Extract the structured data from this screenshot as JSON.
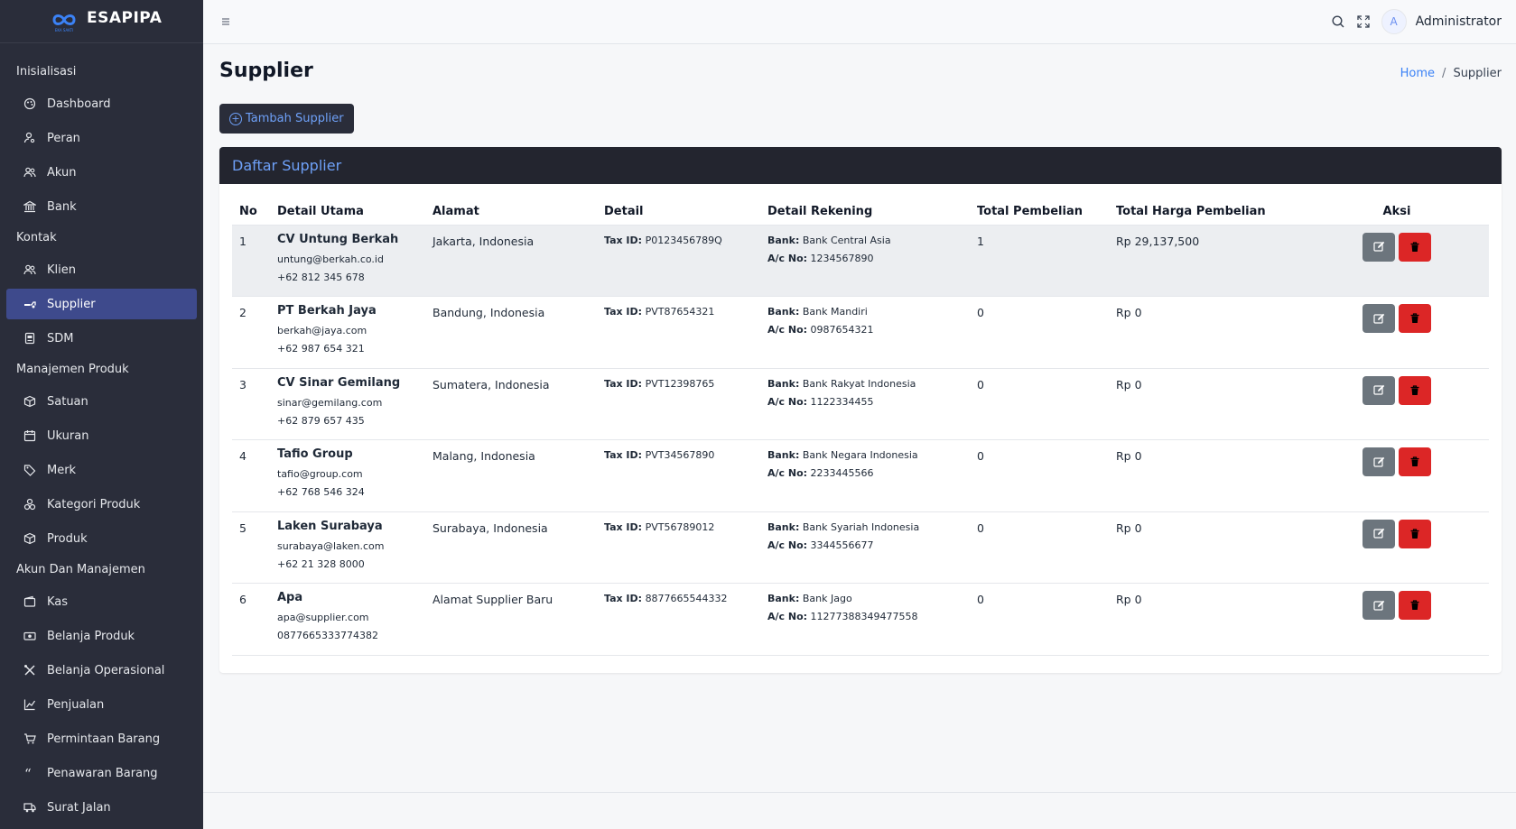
{
  "brand": {
    "name": "ESAPIPA",
    "logo_text": "EKA SAKTI"
  },
  "sidebar": {
    "sections": [
      {
        "title": "Inisialisasi",
        "items": [
          {
            "label": "Dashboard",
            "icon": "palette-icon"
          },
          {
            "label": "Peran",
            "icon": "user-key-icon"
          },
          {
            "label": "Akun",
            "icon": "users-icon"
          },
          {
            "label": "Bank",
            "icon": "bank-icon"
          }
        ]
      },
      {
        "title": "Kontak",
        "items": [
          {
            "label": "Klien",
            "icon": "users-icon"
          },
          {
            "label": "Supplier",
            "icon": "truck-icon",
            "active": true
          },
          {
            "label": "SDM",
            "icon": "id-card-icon"
          }
        ]
      },
      {
        "title": "Manajemen Produk",
        "items": [
          {
            "label": "Satuan",
            "icon": "box-icon"
          },
          {
            "label": "Ukuran",
            "icon": "calendar-icon"
          },
          {
            "label": "Merk",
            "icon": "tag-icon"
          },
          {
            "label": "Kategori Produk",
            "icon": "category-icon"
          },
          {
            "label": "Produk",
            "icon": "box-icon"
          }
        ]
      },
      {
        "title": "Akun Dan Manajemen",
        "items": [
          {
            "label": "Kas",
            "icon": "wallet-icon"
          },
          {
            "label": "Belanja Produk",
            "icon": "money-icon"
          },
          {
            "label": "Belanja Operasional",
            "icon": "tools-icon"
          },
          {
            "label": "Penjualan",
            "icon": "chart-line-icon"
          },
          {
            "label": "Permintaan Barang",
            "icon": "cart-icon"
          },
          {
            "label": "Penawaran Barang",
            "icon": "quote-icon"
          },
          {
            "label": "Surat Jalan",
            "icon": "delivery-truck-icon"
          }
        ]
      }
    ]
  },
  "topbar": {
    "user_initial": "A",
    "user_name": "Administrator"
  },
  "page": {
    "title": "Supplier"
  },
  "breadcrumb": {
    "home": "Home",
    "separator": "/",
    "current": "Supplier"
  },
  "add_button": {
    "label": "Tambah Supplier"
  },
  "card": {
    "title": "Daftar Supplier"
  },
  "table": {
    "headers": [
      "No",
      "Detail Utama",
      "Alamat",
      "Detail",
      "Detail Rekening",
      "Total Pembelian",
      "Total Harga Pembelian",
      "Aksi"
    ],
    "tax_label": "Tax ID:",
    "bank_label": "Bank:",
    "acc_label": "A/c No:",
    "rows": [
      {
        "no": "1",
        "name": "CV Untung Berkah",
        "email": "untung@berkah.co.id",
        "phone": "+62 812 345 678",
        "address": "Jakarta, Indonesia",
        "tax_id": "P0123456789Q",
        "bank": "Bank Central Asia",
        "acc_no": "1234567890",
        "total_purchase": "1",
        "total_price": "Rp 29,137,500"
      },
      {
        "no": "2",
        "name": "PT Berkah Jaya",
        "email": "berkah@jaya.com",
        "phone": "+62 987 654 321",
        "address": "Bandung, Indonesia",
        "tax_id": "PVT87654321",
        "bank": "Bank Mandiri",
        "acc_no": "0987654321",
        "total_purchase": "0",
        "total_price": "Rp 0"
      },
      {
        "no": "3",
        "name": "CV Sinar Gemilang",
        "email": "sinar@gemilang.com",
        "phone": "+62 879 657 435",
        "address": "Sumatera, Indonesia",
        "tax_id": "PVT12398765",
        "bank": "Bank Rakyat Indonesia",
        "acc_no": "1122334455",
        "total_purchase": "0",
        "total_price": "Rp 0"
      },
      {
        "no": "4",
        "name": "Tafio Group",
        "email": "tafio@group.com",
        "phone": "+62 768 546 324",
        "address": "Malang, Indonesia",
        "tax_id": "PVT34567890",
        "bank": "Bank Negara Indonesia",
        "acc_no": "2233445566",
        "total_purchase": "0",
        "total_price": "Rp 0"
      },
      {
        "no": "5",
        "name": "Laken Surabaya",
        "email": "surabaya@laken.com",
        "phone": "+62 21 328 8000",
        "address": "Surabaya, Indonesia",
        "tax_id": "PVT56789012",
        "bank": "Bank Syariah Indonesia",
        "acc_no": "3344556677",
        "total_purchase": "0",
        "total_price": "Rp 0"
      },
      {
        "no": "6",
        "name": "Apa",
        "email": "apa@supplier.com",
        "phone": "0877665333774382",
        "address": "Alamat Supplier Baru",
        "tax_id": "8877665544332",
        "bank": "Bank Jago",
        "acc_no": "11277388349477558",
        "total_purchase": "0",
        "total_price": "Rp 0"
      }
    ]
  },
  "colors": {
    "sidebar_bg": "#2a2d3a",
    "active_item": "#3e4a8c",
    "accent": "#6ea0f7",
    "edit_button": "#6c757d",
    "delete_button": "#dc2626"
  }
}
